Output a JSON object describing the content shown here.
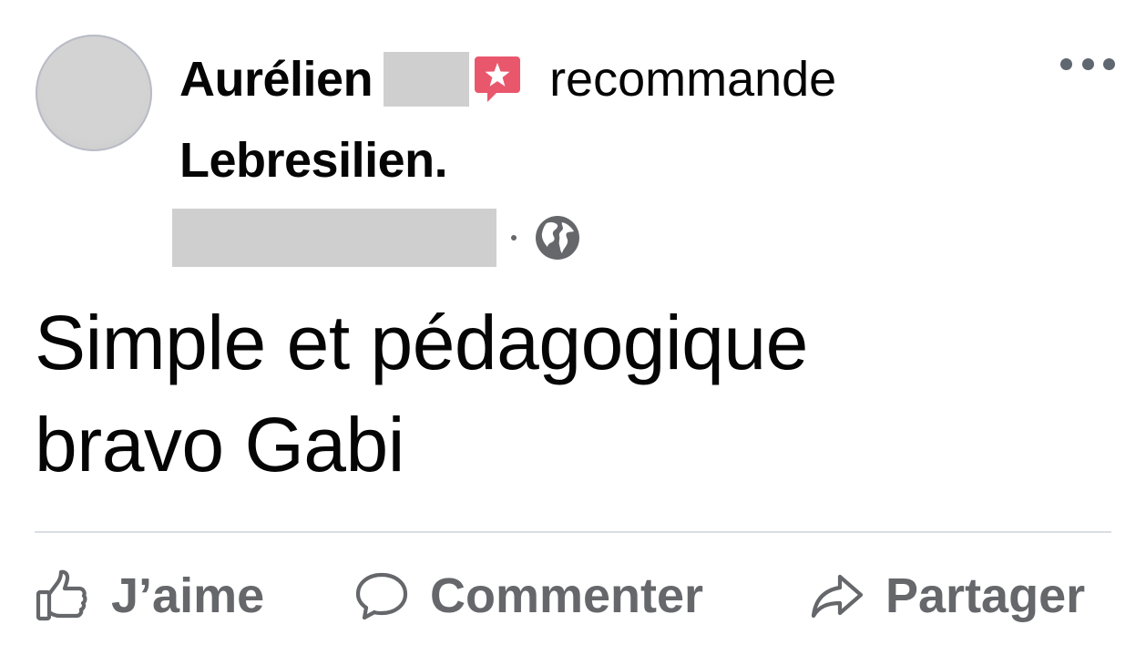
{
  "post": {
    "author_first_name": "Aurélien",
    "recommend_text": "recommande",
    "recommended_page": "Lebresilien.",
    "privacy_icon": "globe-icon",
    "body_line1": "Simple et pédagogique",
    "body_line2": "bravo Gabi"
  },
  "actions": {
    "like_label": "J’aime",
    "comment_label": "Commenter",
    "share_label": "Partager"
  },
  "icons": {
    "recommend": "recommend-star-icon",
    "more": "more-options-icon",
    "like": "thumbs-up-icon",
    "comment": "comment-bubble-icon",
    "share": "share-arrow-icon"
  },
  "colors": {
    "recommend_accent": "#e9576c",
    "action_gray": "#65676b",
    "text": "#050505",
    "divider": "#dadde1"
  }
}
